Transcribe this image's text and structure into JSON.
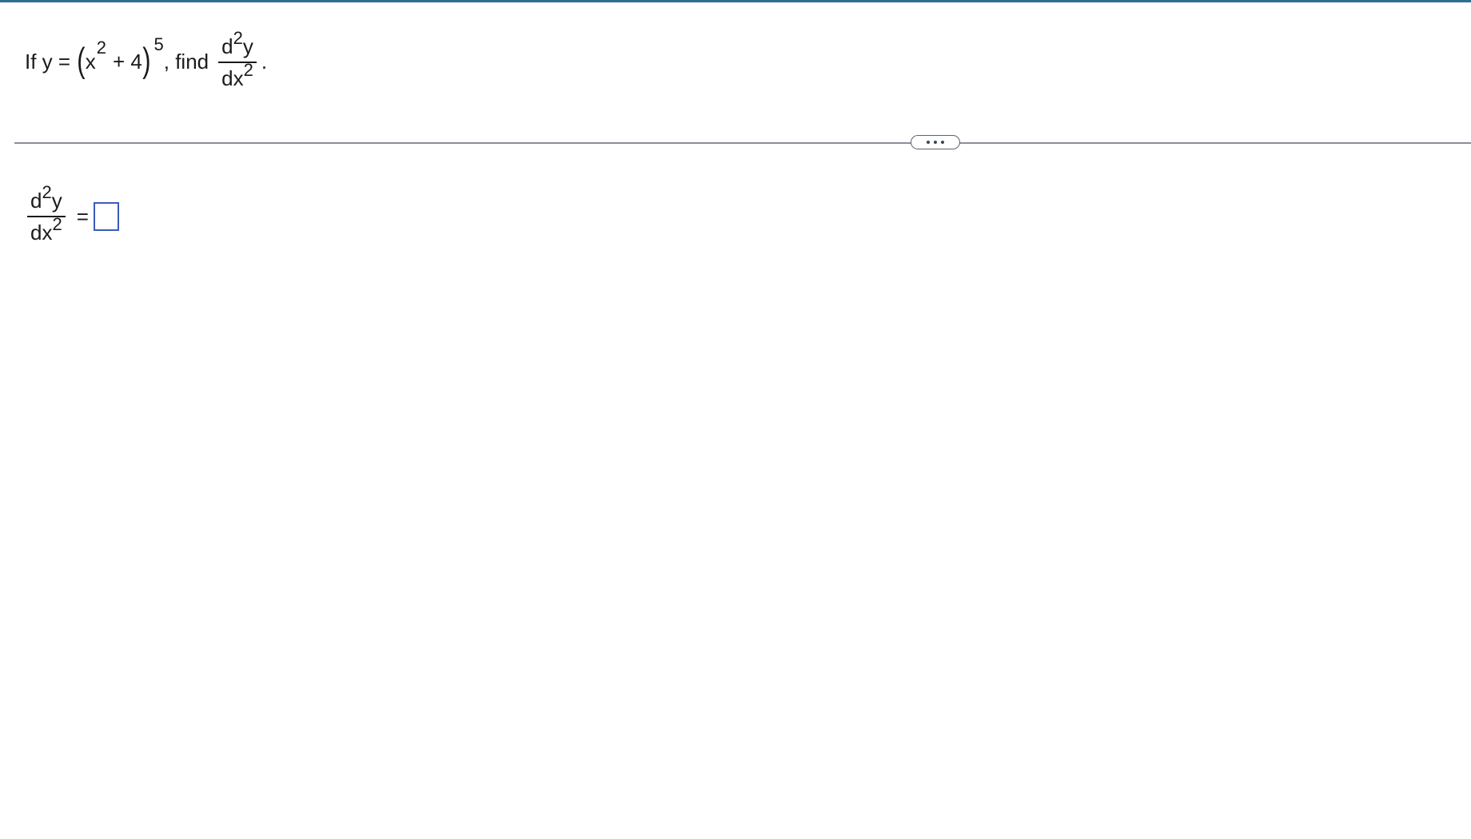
{
  "question": {
    "prefix": "If y =",
    "base_var": "x",
    "base_exp": "2",
    "plus_term": "+ 4",
    "outer_exp": "5",
    "find_text": ", find",
    "deriv_num_d": "d",
    "deriv_num_exp": "2",
    "deriv_num_var": "y",
    "deriv_den_d": "dx",
    "deriv_den_exp": "2",
    "period": "."
  },
  "divider": {
    "more_icon": "ellipsis-icon"
  },
  "answer": {
    "lhs_num_d": "d",
    "lhs_num_exp": "2",
    "lhs_num_var": "y",
    "lhs_den_d": "dx",
    "lhs_den_exp": "2",
    "equals": "=",
    "value": ""
  },
  "colors": {
    "top_rule": "#2f6e93",
    "answer_box_border": "#3b5bb8",
    "divider": "#8a8f96"
  }
}
